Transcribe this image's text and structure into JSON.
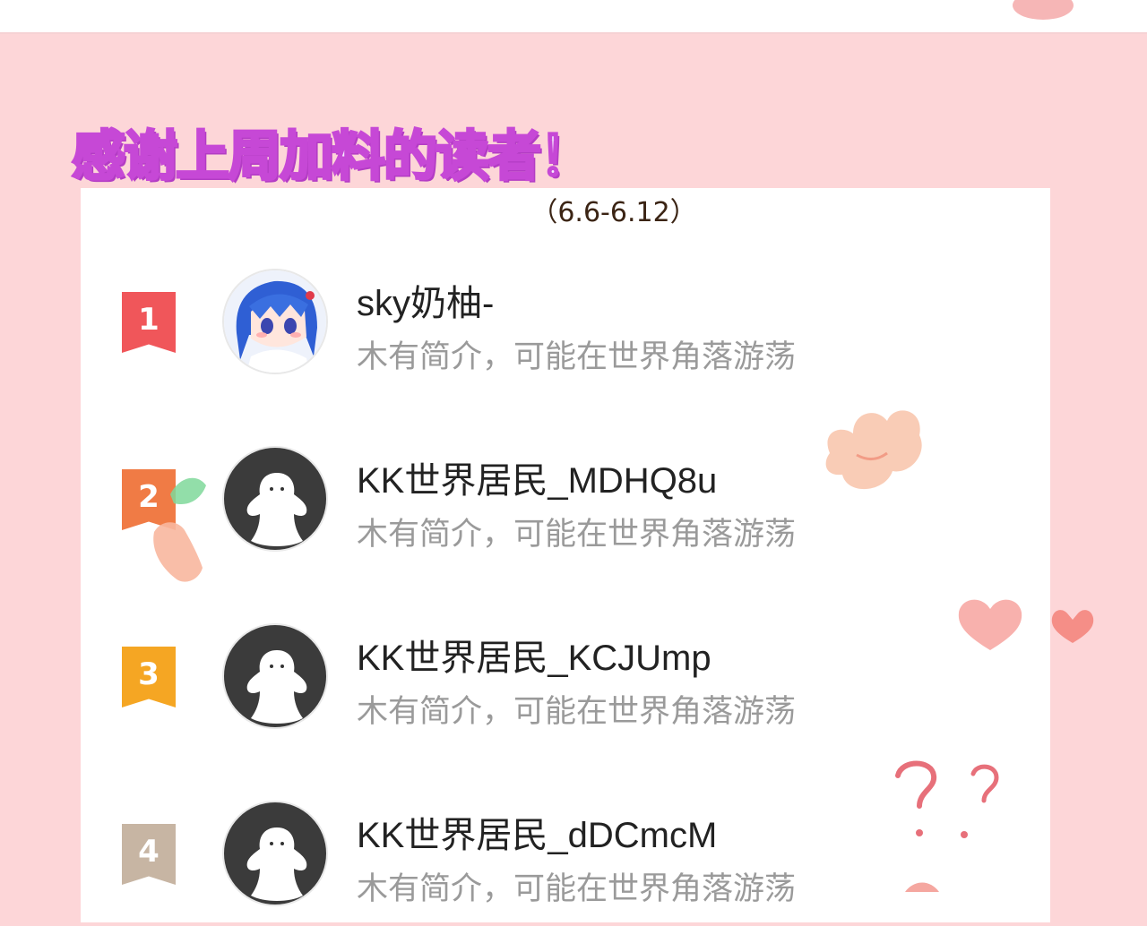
{
  "heading": "感谢上周加料的读者！",
  "date_range": "（6.6-6.12）",
  "colors": {
    "background": "#fdd6d8",
    "heading_fill": "#f7ecff",
    "heading_outline": "#c648d6",
    "rank_1": "#f0565a",
    "rank_2": "#f07b45",
    "rank_3": "#f5a623",
    "rank_4": "#c7b5a3"
  },
  "readers": [
    {
      "rank": "1",
      "name": "sky奶柚-",
      "bio": "木有简介，可能在世界角落游荡",
      "avatar": "anime-girl-avatar"
    },
    {
      "rank": "2",
      "name": "KK世界居民_MDHQ8u",
      "bio": "木有简介，可能在世界角落游荡",
      "avatar": "default-ghost-avatar"
    },
    {
      "rank": "3",
      "name": "KK世界居民_KCJUmp",
      "bio": "木有简介，可能在世界角落游荡",
      "avatar": "default-ghost-avatar"
    },
    {
      "rank": "4",
      "name": "KK世界居民_dDCmcM",
      "bio": "木有简介，可能在世界角落游荡",
      "avatar": "default-ghost-avatar"
    }
  ],
  "decorations": [
    "flower-sticker",
    "hand-holding-leaf-sticker",
    "heart-stickers",
    "question-marks-doodle"
  ]
}
